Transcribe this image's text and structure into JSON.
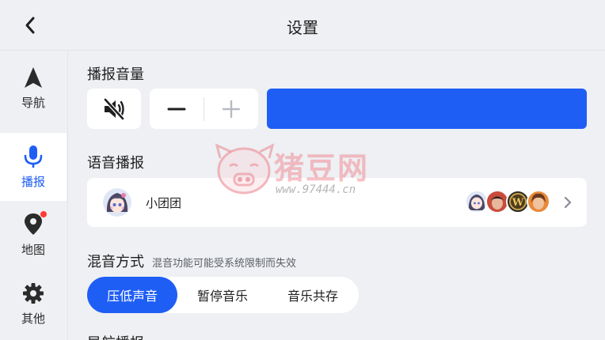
{
  "header": {
    "title": "设置"
  },
  "sidebar": {
    "items": [
      {
        "label": "导航",
        "icon": "navigation-arrow-icon",
        "active": false
      },
      {
        "label": "播报",
        "icon": "microphone-icon",
        "active": true
      },
      {
        "label": "地图",
        "icon": "map-pin-icon",
        "active": false,
        "badge": true
      },
      {
        "label": "其他",
        "icon": "gear-icon",
        "active": false
      }
    ]
  },
  "volume": {
    "title": "播报音量",
    "level_percent": 100,
    "accent": "#1f5ef5"
  },
  "voice": {
    "title": "语音播报",
    "current_voice": "小团团"
  },
  "mix": {
    "title": "混音方式",
    "hint": "混音功能可能受系统限制而失效",
    "options": [
      "压低声音",
      "暂停音乐",
      "音乐共存"
    ],
    "selected": "压低声音"
  },
  "next_section": {
    "title": "导航播报"
  },
  "watermark": {
    "text": "猪豆网",
    "url": "www.97444.cn"
  }
}
